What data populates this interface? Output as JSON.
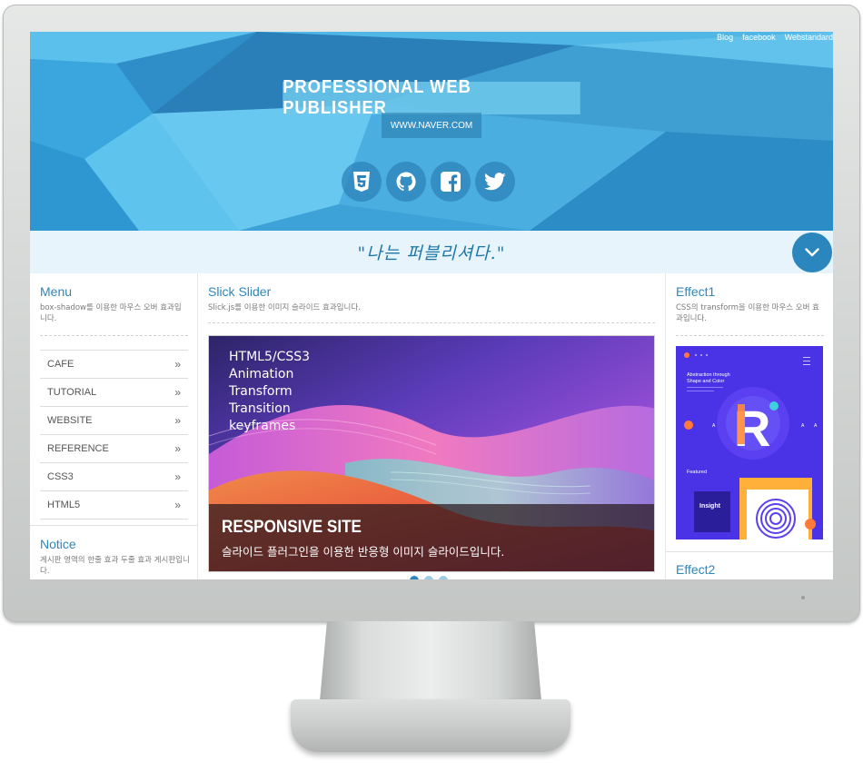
{
  "header": {
    "top_links": [
      "Blog",
      "facebook",
      "Webstandard"
    ],
    "title": "PROFESSIONAL WEB PUBLISHER",
    "url": "WWW.NAVER.COM",
    "social_icons": [
      "html5-icon",
      "github-icon",
      "facebook-icon",
      "twitter-icon"
    ]
  },
  "quote": "\"나는 퍼블리셔다.\"",
  "menu": {
    "title": "Menu",
    "desc": "box-shadow를 이용한 마우스 오버 효과입니다.",
    "items": [
      {
        "label": "CAFE"
      },
      {
        "label": "TUTORIAL"
      },
      {
        "label": "WEBSITE"
      },
      {
        "label": "REFERENCE"
      },
      {
        "label": "CSS3"
      },
      {
        "label": "HTML5"
      }
    ],
    "arrow": "»"
  },
  "notice": {
    "title": "Notice",
    "desc": "게시판 영역의 한줄 효과 두줄 효과 게시판입니다."
  },
  "slider": {
    "title": "Slick Slider",
    "desc": "Slick.js를 이용한 이미지 슬라이드 효과입니다.",
    "tags": [
      "HTML5/CSS3",
      "Animation",
      "Transform",
      "Transition",
      "keyframes"
    ],
    "caption_title": "RESPONSIVE SITE",
    "caption_desc": "슬라이드 플러그인을 이용한 반응형 이미지 슬라이드입니다.",
    "dots": 3,
    "active_dot": 0
  },
  "effect1": {
    "title": "Effect1",
    "desc": "CSS의 transform을 이용한 마우스 오버 효과입니다.",
    "thumb": {
      "heading": "Abstraction through Shape and Color",
      "letter": "R",
      "featured": "Featured",
      "insight": "Insight"
    }
  },
  "effect2": {
    "title": "Effect2"
  },
  "colors": {
    "accent": "#2f86b9",
    "header_bg": "#3aa1d6",
    "banner_bg": "#e7f4fb"
  }
}
